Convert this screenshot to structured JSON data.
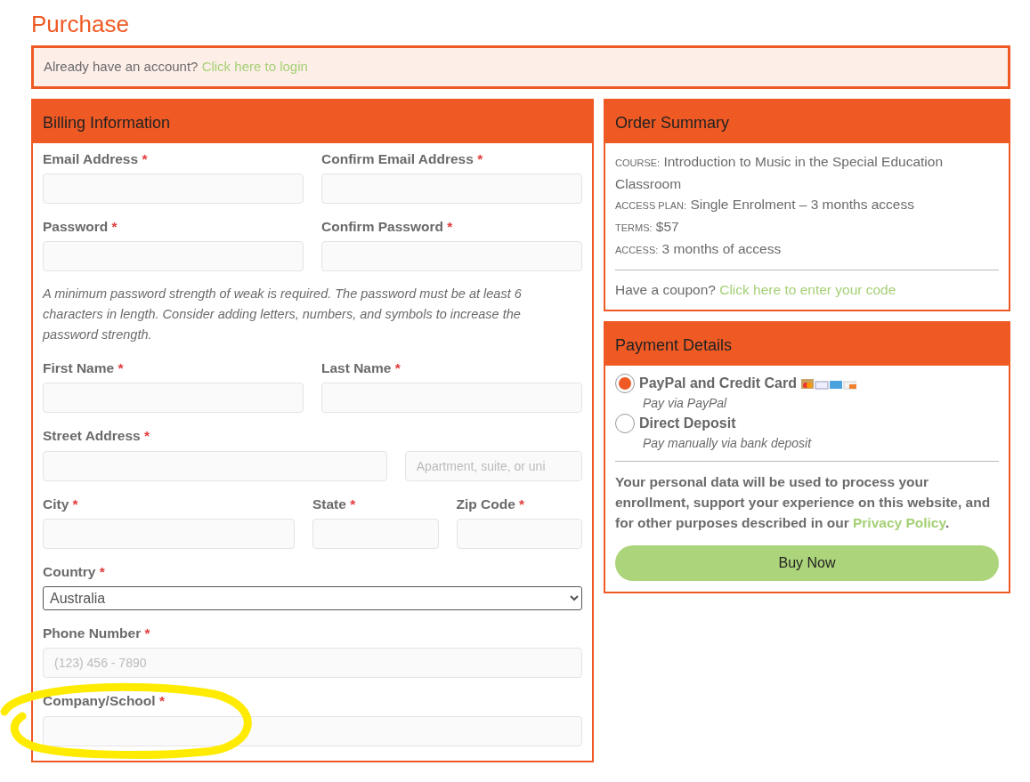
{
  "title": "Purchase",
  "login_notice": {
    "text": "Already have an account?",
    "link": "Click here to login"
  },
  "billing": {
    "heading": "Billing Information",
    "rows": [
      {
        "kind": "fields",
        "fields": [
          {
            "label": "Email Address",
            "required_mark": "*"
          },
          {
            "label": "Confirm Email Address",
            "required_mark": "*"
          }
        ]
      },
      {
        "kind": "fields",
        "fields": [
          {
            "label": "Password",
            "required_mark": "*"
          },
          {
            "label": "Confirm Password",
            "required_mark": "*"
          }
        ]
      },
      {
        "kind": "note",
        "text": "A minimum password strength of weak is required. The password must be at least 6 characters in length. Consider adding letters, numbers, and symbols to increase the password strength."
      },
      {
        "kind": "fields",
        "fields": [
          {
            "label": "First Name",
            "required_mark": "*"
          },
          {
            "label": "Last Name",
            "required_mark": "*"
          }
        ]
      },
      {
        "kind": "fields",
        "fields": [
          {
            "label": "Street Address",
            "required_mark": "*"
          },
          {
            "placeholder": "Apartment, suite, or uni"
          }
        ]
      },
      {
        "kind": "fields",
        "fields": [
          {
            "label": "City",
            "required_mark": "*"
          },
          {
            "label": "State",
            "required_mark": "*"
          },
          {
            "label": "Zip Code",
            "required_mark": "*"
          }
        ]
      },
      {
        "kind": "fields",
        "fields": [
          {
            "label": "Country",
            "required_mark": "*",
            "kind": "select",
            "value": "Australia"
          }
        ]
      },
      {
        "kind": "fields",
        "fields": [
          {
            "label": "Phone Number",
            "required_mark": "*",
            "placeholder": "(123) 456 - 7890"
          }
        ]
      },
      {
        "kind": "fields",
        "fields": [
          {
            "label": "Company/School",
            "required_mark": "*"
          }
        ]
      }
    ]
  },
  "order_summary": {
    "heading": "Order Summary",
    "lines": [
      {
        "label": "COURSE:",
        "value": "Introduction to Music in the Special Education Classroom"
      },
      {
        "label": "ACCESS PLAN:",
        "value": "Single Enrolment – 3 months access"
      },
      {
        "label": "TERMS:",
        "value": "$57"
      },
      {
        "label": "ACCESS:",
        "value": "3 months of access"
      }
    ],
    "coupon": {
      "text": "Have a coupon?",
      "link": "Click here to enter your code"
    }
  },
  "payment": {
    "heading": "Payment Details",
    "methods": [
      {
        "title": "PayPal and Credit Card",
        "description": "Pay via PayPal",
        "selected": true,
        "card_logos": true
      },
      {
        "title": "Direct Deposit",
        "description": "Pay manually via bank deposit",
        "selected": false,
        "card_logos": false
      }
    ],
    "consent": {
      "text": "Your personal data will be used to process your enrollment, support your experience on this website, and for other purposes described in our",
      "link": "Privacy Policy",
      "after": "."
    },
    "button": "Buy Now"
  }
}
